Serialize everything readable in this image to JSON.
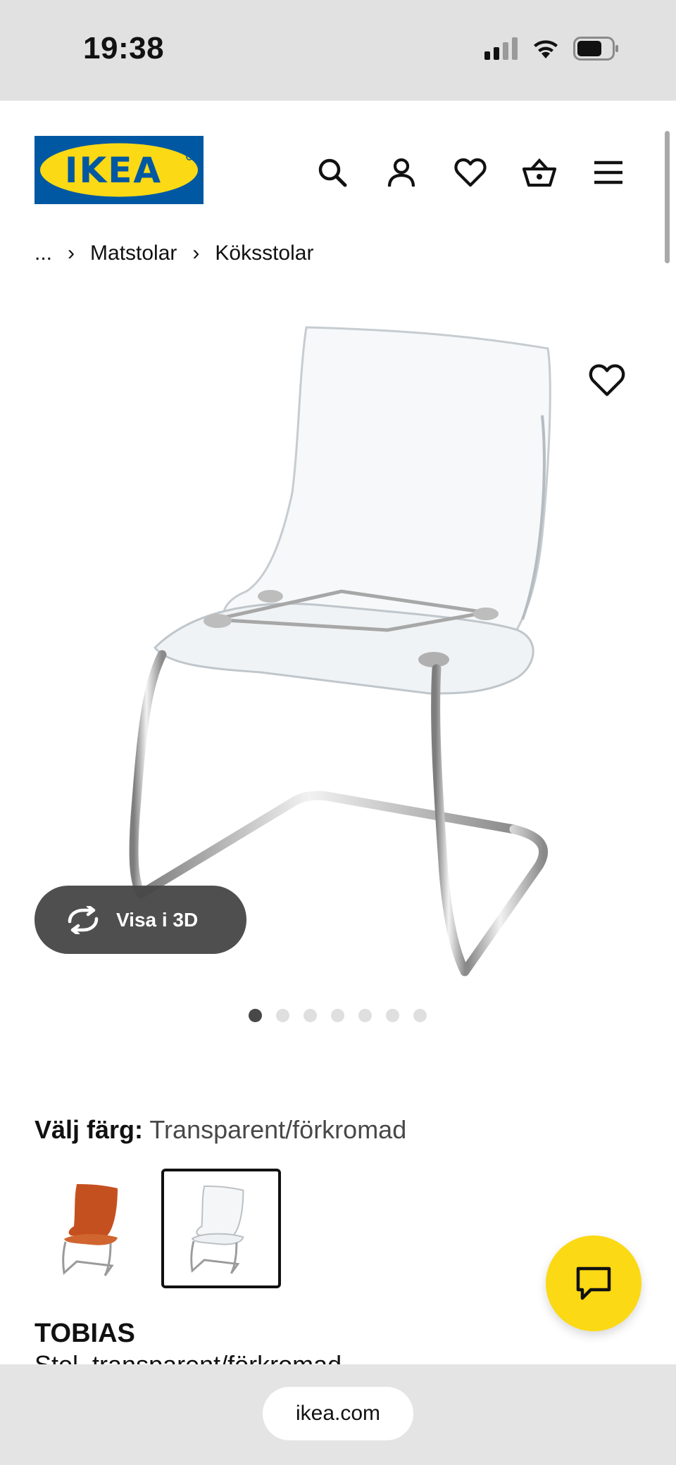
{
  "status_bar": {
    "time": "19:38"
  },
  "header": {
    "logo_text": "IKEA",
    "icons": [
      "search-icon",
      "user-icon",
      "heart-icon",
      "basket-icon",
      "menu-icon"
    ]
  },
  "breadcrumb": {
    "ellipsis": "...",
    "items": [
      "Matstolar",
      "Köksstolar"
    ],
    "separator": "›"
  },
  "gallery": {
    "view_3d_label": "Visa i 3D",
    "dots_total": 7,
    "active_dot": 1
  },
  "color": {
    "label": "Välj färg:",
    "value": "Transparent/förkromad"
  },
  "product": {
    "name": "TOBIAS",
    "subtitle": "Stol, transparent/förkromad"
  },
  "browser": {
    "url": "ikea.com"
  },
  "colors": {
    "ikea_blue": "#0058a3",
    "ikea_yellow": "#fbd914"
  }
}
